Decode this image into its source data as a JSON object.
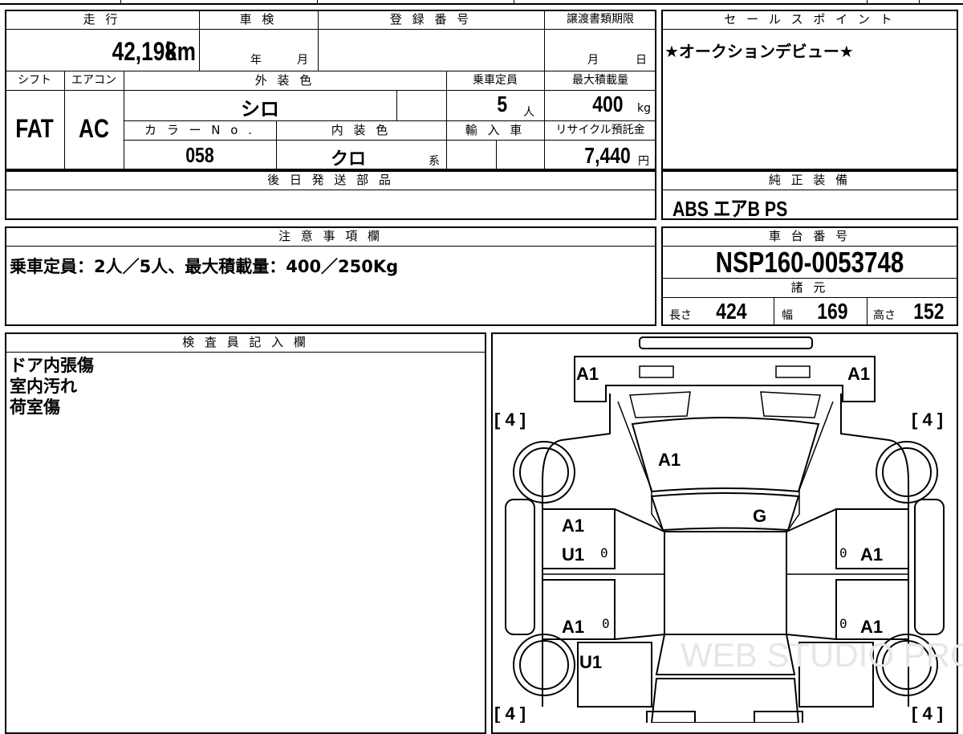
{
  "vehicle_info": {
    "labels": {
      "mileage": "走 行",
      "inspection": "車 検",
      "registration_number": "登 録 番 号",
      "transfer_deadline": "譲渡書類期限",
      "shift": "シフト",
      "aircon": "エアコン",
      "exterior_color": "外 装 色",
      "capacity": "乗車定員",
      "max_load": "最大積載量",
      "color_no": "カ ラ ー N o .",
      "interior_color": "内 装 色",
      "import": "輸 入 車",
      "recycle_fee": "リサイクル預託金",
      "later_parts": "後 日 発 送 部 品",
      "notes": "注 意 事 項 欄",
      "inspector": "検 査 員 記 入 欄"
    },
    "mileage_value": "42,198",
    "mileage_unit": "km",
    "inspection_year_unit": "年",
    "inspection_month_unit": "月",
    "deadline_month_unit": "月",
    "deadline_day_unit": "日",
    "shift": "FAT",
    "aircon": "AC",
    "exterior_color": "シロ",
    "capacity_value": "5",
    "capacity_unit": "人",
    "max_load_value": "400",
    "max_load_unit": "kg",
    "color_no": "058",
    "interior_color": "クロ",
    "interior_suffix": "系",
    "recycle_fee_value": "7,440",
    "recycle_fee_unit": "円"
  },
  "sales_point": {
    "title": "セ ー ル ス ポ イ ン ト",
    "text": "★オークションデビュー★"
  },
  "genuine_equipment": {
    "title": "純 正 装 備",
    "text": "ABS エアB PS"
  },
  "notes": {
    "text": "乗車定員：2人／5人、最大積載量：400／250Kg"
  },
  "chassis": {
    "title": "車 台 番 号",
    "number": "NSP160-0053748"
  },
  "specs": {
    "title": "諸 元",
    "length_label": "長さ",
    "length_value": "424",
    "width_label": "幅",
    "width_value": "169",
    "height_label": "高さ",
    "height_value": "152"
  },
  "inspector": {
    "lines": [
      "ドア内張傷",
      "室内汚れ",
      "荷室傷"
    ]
  },
  "diagram": {
    "marks": {
      "front_left": "A1",
      "front_right": "A1",
      "hood": "A1",
      "windshield": "G",
      "left_front_door": "A1",
      "left_front_door_2": "U1",
      "left_rear_door": "A1",
      "left_rear_quarter": "U1",
      "right_front_door": "A1",
      "right_rear_door": "A1",
      "tire_fl": "[ 4 ]",
      "tire_fr": "[ 4 ]",
      "tire_rl": "[ 4 ]",
      "tire_rr": "[ 4 ]",
      "zero_1": "0",
      "zero_2": "0",
      "zero_3": "0",
      "zero_4": "0"
    },
    "watermark": "WEB STUDIO PRO"
  }
}
